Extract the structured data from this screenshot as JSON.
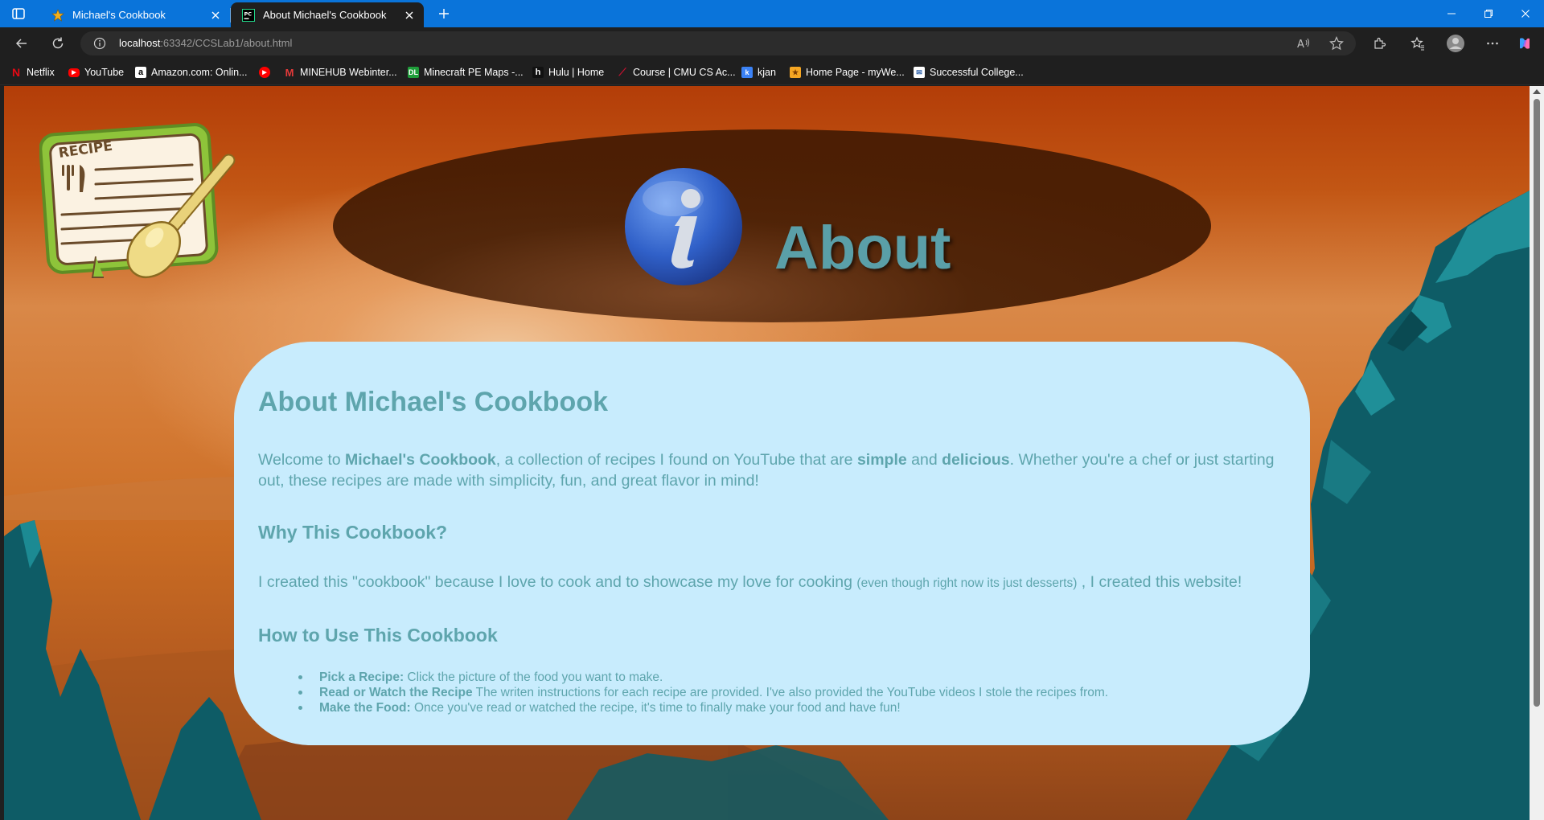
{
  "browser": {
    "tabs": [
      {
        "title": "Michael's Cookbook",
        "icon": "star-icon",
        "active": false
      },
      {
        "title": "About Michael's Cookbook",
        "icon": "pycharm-icon",
        "active": true
      }
    ],
    "address": {
      "host": "localhost",
      "rest": ":63342/CCSLab1/about.html"
    },
    "bookmarks": [
      {
        "label": "Netflix",
        "icon": "netflix-icon",
        "color": "#e50914"
      },
      {
        "label": "YouTube",
        "icon": "youtube-icon",
        "color": "#ff0000"
      },
      {
        "label": "Amazon.com: Onlin...",
        "icon": "amazon-icon",
        "color": "#ffffff"
      },
      {
        "label": "",
        "icon": "youtube-icon",
        "color": "#ff0000"
      },
      {
        "label": "MINEHUB Webinter...",
        "icon": "minehub-icon",
        "color": "#e53a3a"
      },
      {
        "label": "Minecraft PE Maps -...",
        "icon": "dl-icon",
        "color": "#1f9d3a"
      },
      {
        "label": "Hulu | Home",
        "icon": "hulu-icon",
        "color": "#111111"
      },
      {
        "label": "Course | CMU CS Ac...",
        "icon": "cmu-icon",
        "color": "#c41230"
      },
      {
        "label": "kjan",
        "icon": "kjan-icon",
        "color": "#3b82f6"
      },
      {
        "label": "Home Page - myWe...",
        "icon": "myweb-icon",
        "color": "#f5a623"
      },
      {
        "label": "Successful College...",
        "icon": "college-icon",
        "color": "#2b5fa8"
      }
    ]
  },
  "page": {
    "header_title": "About",
    "logo_text": "RECIPE",
    "card": {
      "heading": "About Michael's Cookbook",
      "intro": {
        "p1": "Welcome to ",
        "b1": "Michael's Cookbook",
        "p2": ", a collection of recipes I found on YouTube that are ",
        "b2": "simple",
        "p3": " and ",
        "b3": "delicious",
        "p4": ". Whether you're a chef or just starting out, these recipes are made with simplicity, fun, and great flavor in mind!"
      },
      "why_heading": "Why This Cookbook?",
      "why_text": {
        "main": "I created this \"cookbook\" because I love to cook and to showcase my love for cooking ",
        "small": "(even though right now its just desserts)",
        "end": " , I created this website!"
      },
      "howto_heading": "How to Use This Cookbook",
      "steps": [
        {
          "label": "Pick a Recipe:",
          "text": " Click the picture of the food you want to make."
        },
        {
          "label": "Read or Watch the Recipe",
          "text": " The writen instructions for each recipe are provided. I've also provided the YouTube videos I stole the recipes from."
        },
        {
          "label": "Make the Food:",
          "text": " Once you've read or watched the recipe, it's time to finally make your food and have fun!"
        }
      ]
    }
  },
  "colors": {
    "title_bar": "#0a74da",
    "card_bg": "#c8ecfd",
    "card_text": "#5ea5ad",
    "header_ellipse": "#461c03",
    "mountain": "#0e5c66"
  }
}
